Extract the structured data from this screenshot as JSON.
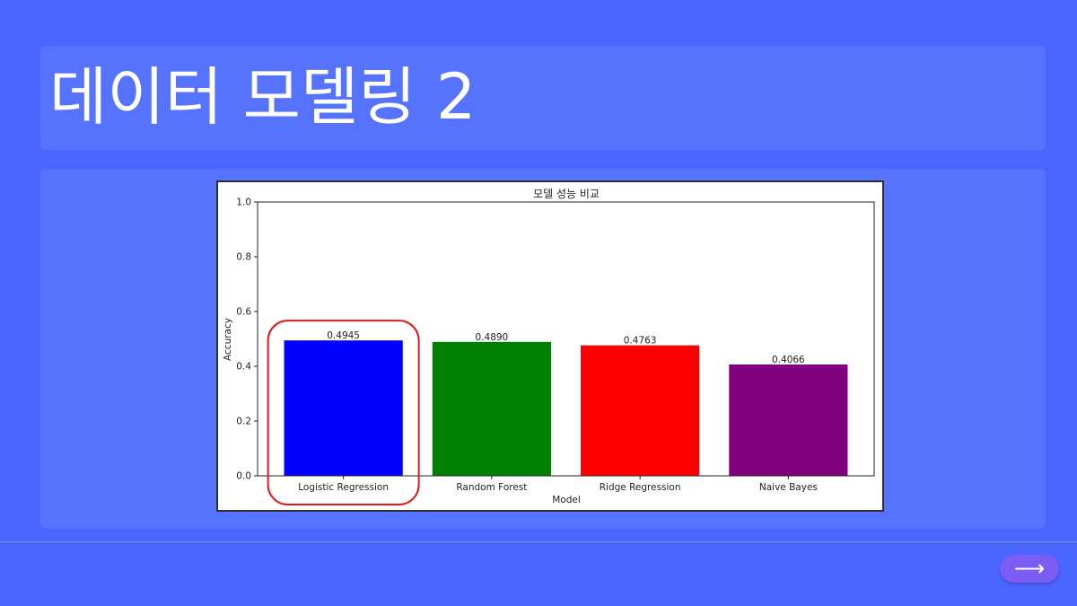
{
  "slide": {
    "title": "데이터 모델링 2"
  },
  "navigation": {
    "next_icon": "arrow-right-icon",
    "next_glyph": "⟶"
  },
  "colors": {
    "background": "#4a66ff",
    "panel": "#5673ff",
    "highlight_circle": "#e01818",
    "next_button": "#7b5cf5"
  },
  "chart_data": {
    "type": "bar",
    "title": "모델 성능 비교",
    "xlabel": "Model",
    "ylabel": "Accuracy",
    "ylim": [
      0,
      1.0
    ],
    "yticks": [
      "0.0",
      "0.2",
      "0.4",
      "0.6",
      "0.8",
      "1.0"
    ],
    "categories": [
      "Logistic Regression",
      "Random Forest",
      "Ridge Regression",
      "Naive Bayes"
    ],
    "values": [
      0.4945,
      0.489,
      0.4763,
      0.4066
    ],
    "value_labels": [
      "0.4945",
      "0.4890",
      "0.4763",
      "0.4066"
    ],
    "colors": [
      "#0000ff",
      "#008000",
      "#ff0000",
      "#800080"
    ],
    "grid": false,
    "legend": "none",
    "highlighted_category": "Logistic Regression"
  }
}
